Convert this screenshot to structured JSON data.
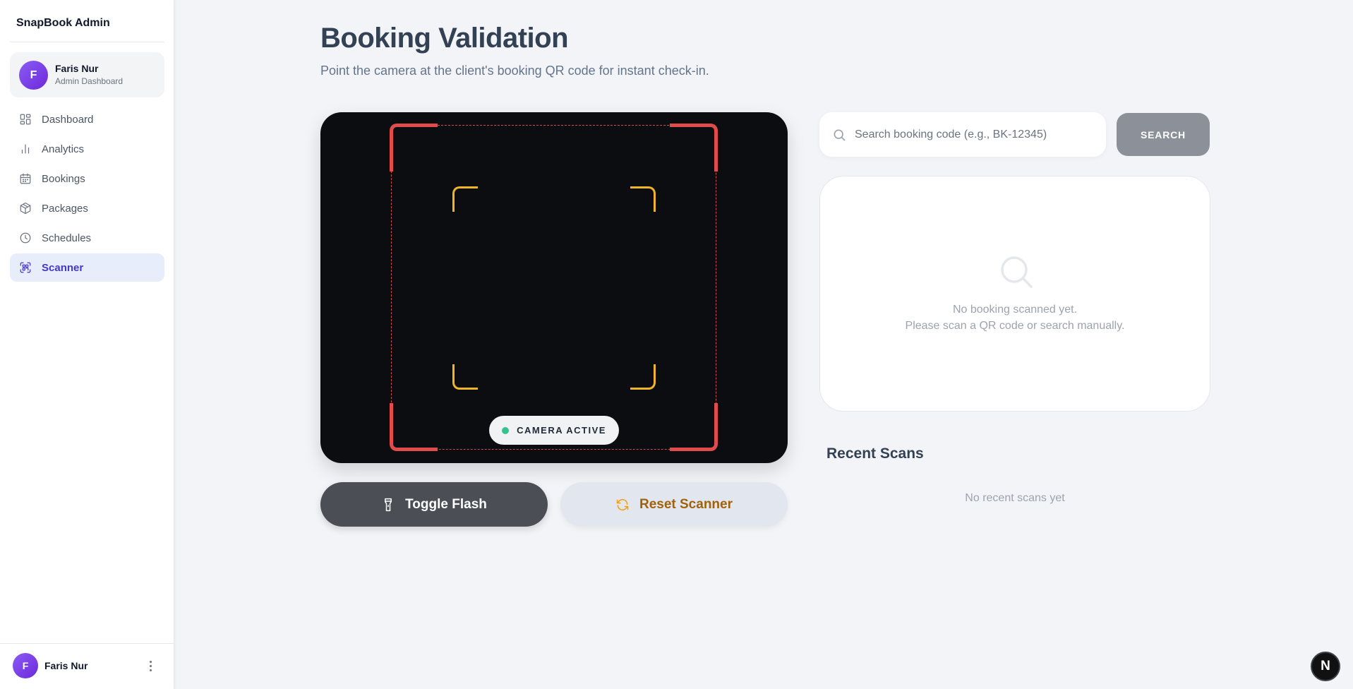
{
  "sidebar": {
    "brand": "SnapBook Admin",
    "user": {
      "initial": "F",
      "name": "Faris Nur",
      "role": "Admin Dashboard"
    },
    "items": [
      {
        "label": "Dashboard",
        "icon": "dashboard-icon"
      },
      {
        "label": "Analytics",
        "icon": "analytics-icon"
      },
      {
        "label": "Bookings",
        "icon": "calendar-icon"
      },
      {
        "label": "Packages",
        "icon": "package-icon"
      },
      {
        "label": "Schedules",
        "icon": "clock-icon"
      },
      {
        "label": "Scanner",
        "icon": "scan-icon",
        "active": true
      }
    ],
    "footer_user": {
      "initial": "F",
      "name": "Faris Nur"
    }
  },
  "main": {
    "title": "Booking Validation",
    "subtitle": "Point the camera at the client's booking QR code for instant check-in.",
    "camera_status": "CAMERA ACTIVE",
    "buttons": {
      "flash": "Toggle Flash",
      "reset": "Reset Scanner"
    }
  },
  "search": {
    "placeholder": "Search booking code (e.g., BK-12345)",
    "value": "",
    "button_label": "SEARCH"
  },
  "result": {
    "empty_line1": "No booking scanned yet.",
    "empty_line2": "Please scan a QR code or search manually."
  },
  "recent": {
    "title": "Recent Scans",
    "empty": "No recent scans yet"
  },
  "dev_badge": "N",
  "colors": {
    "accent": "#4338ca",
    "camera_bg": "#0b0d10",
    "frame_red": "#e24b4b",
    "focus_yellow": "#f0b429",
    "status_green": "#34c38f",
    "reset_text": "#a16207"
  }
}
